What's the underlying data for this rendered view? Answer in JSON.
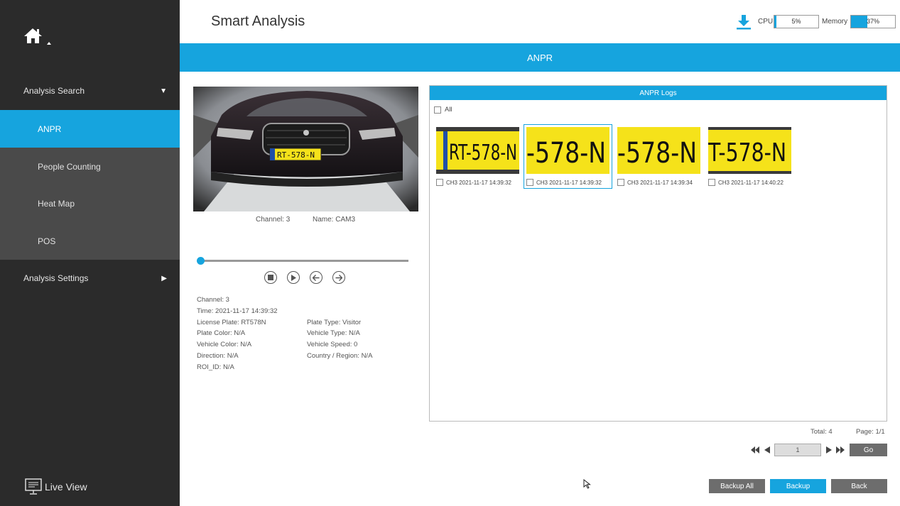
{
  "sidebar": {
    "home_icon": "home-icon",
    "analysis_search": "Analysis Search",
    "items": [
      {
        "label": "ANPR",
        "active": true
      },
      {
        "label": "People Counting",
        "active": false
      },
      {
        "label": "Heat Map",
        "active": false
      },
      {
        "label": "POS",
        "active": false
      }
    ],
    "analysis_settings": "Analysis Settings",
    "live_view": "Live View"
  },
  "header": {
    "title": "Smart Analysis",
    "cpu_label": "CPU",
    "cpu_value": "5%",
    "cpu_fraction": 0.05,
    "memory_label": "Memory",
    "memory_value": "37%",
    "memory_fraction": 0.37
  },
  "banner": {
    "title": "ANPR"
  },
  "preview": {
    "channel": "Channel: 3",
    "name": "Name: CAM3",
    "plate_text": "RT-578-N",
    "slider_progress": 0
  },
  "details": {
    "channel": "Channel: 3",
    "time": "Time: 2021-11-17 14:39:32",
    "license_plate": "License Plate: RT578N",
    "plate_type": "Plate Type: Visitor",
    "plate_color": "Plate Color: N/A",
    "vehicle_type": "Vehicle Type: N/A",
    "vehicle_color": "Vehicle Color: N/A",
    "vehicle_speed": "Vehicle Speed: 0",
    "direction": "Direction: N/A",
    "country_region": "Country / Region: N/A",
    "roi_id": "ROI_ID: N/A"
  },
  "logs": {
    "title": "ANPR Logs",
    "all_label": "All",
    "entries": [
      {
        "caption": "CH3  2021-11-17 14:39:32",
        "plate_text": "RT-578-N",
        "selected": false
      },
      {
        "caption": "CH3  2021-11-17 14:39:32",
        "plate_text": "-578-N",
        "selected": true
      },
      {
        "caption": "CH3  2021-11-17 14:39:34",
        "plate_text": "-578-N",
        "selected": false
      },
      {
        "caption": "CH3  2021-11-17 14:40:22",
        "plate_text": "T-578-N",
        "selected": false
      }
    ]
  },
  "pagination": {
    "total": "Total: 4",
    "page": "Page: 1/1",
    "page_input": "1",
    "go": "Go"
  },
  "actions": {
    "backup_all": "Backup All",
    "backup": "Backup",
    "back": "Back"
  },
  "colors": {
    "accent": "#16a4de",
    "sidebar_bg": "#2b2b2b",
    "submenu_bg": "#4a4a4a",
    "plate_yellow": "#f5e21a"
  }
}
